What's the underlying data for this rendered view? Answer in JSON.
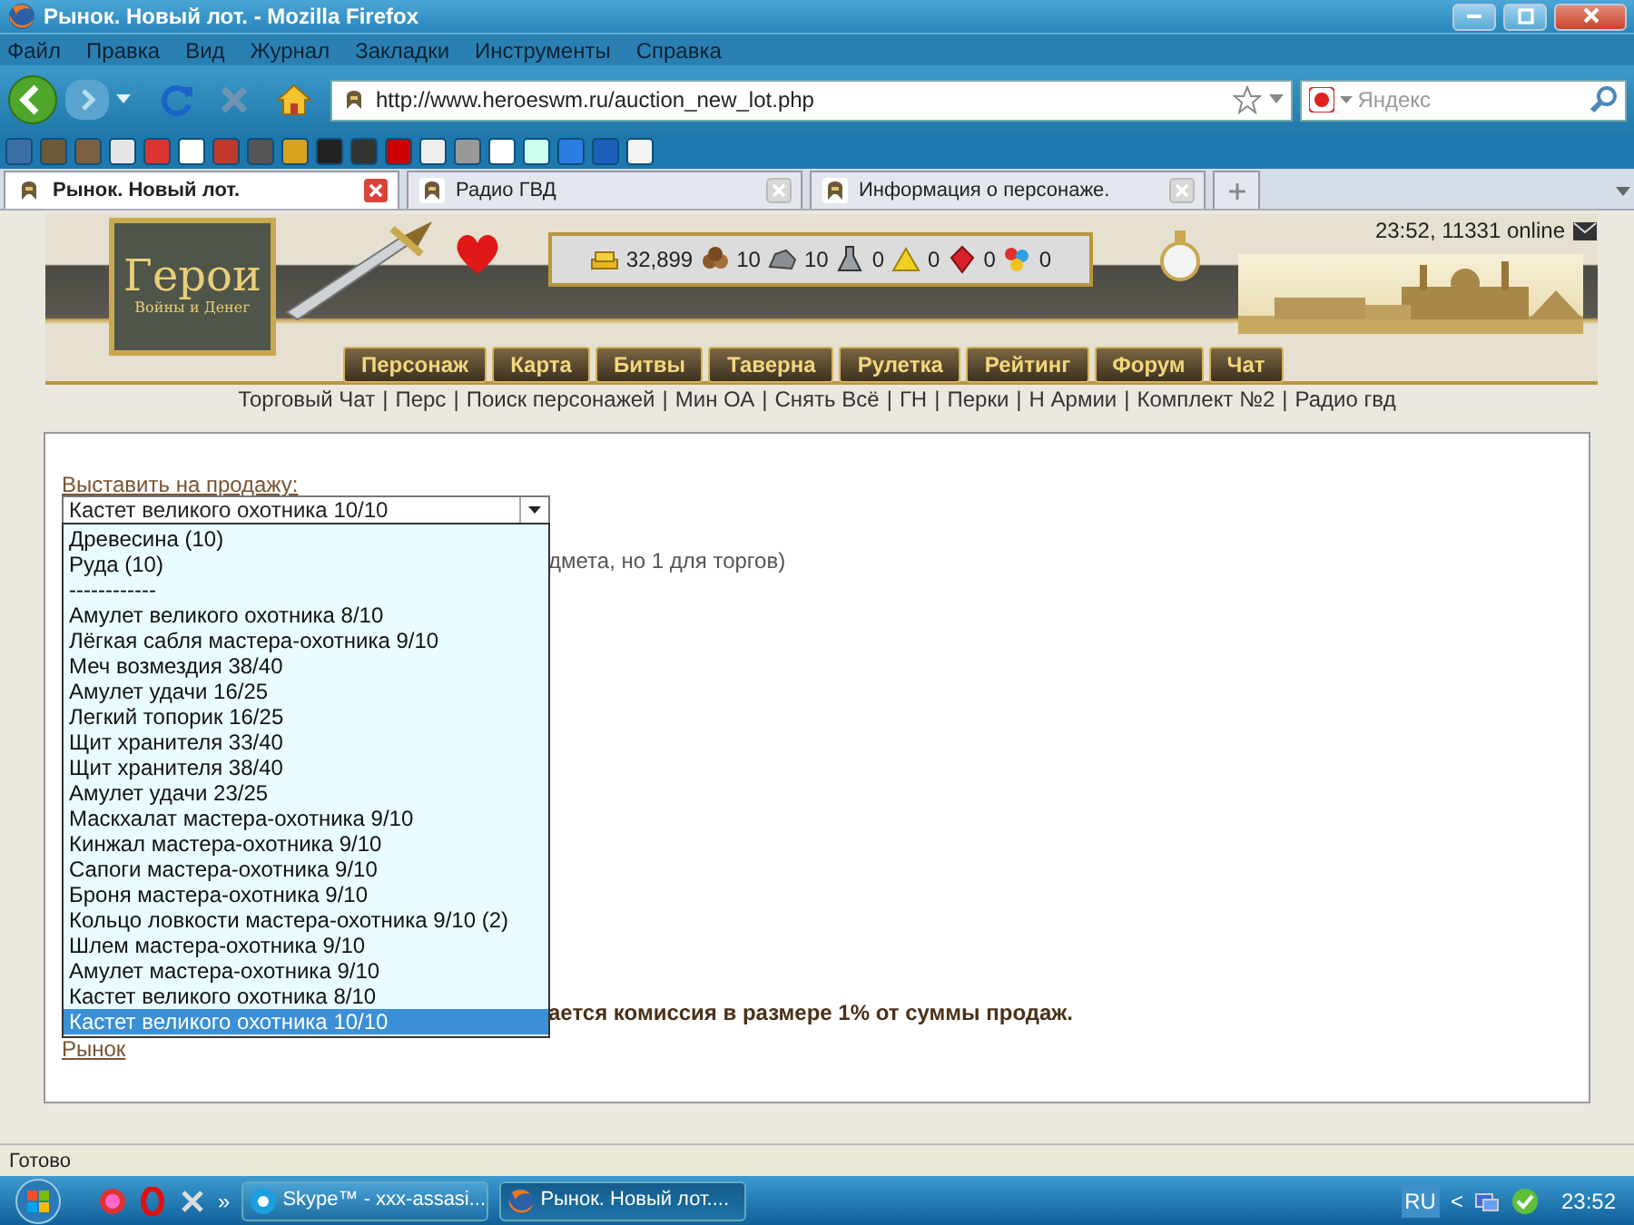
{
  "window": {
    "title": "Рынок. Новый лот. - Mozilla Firefox"
  },
  "menu": [
    "Файл",
    "Правка",
    "Вид",
    "Журнал",
    "Закладки",
    "Инструменты",
    "Справка"
  ],
  "address_bar": {
    "url": "http://www.heroeswm.ru/auction_new_lot.php"
  },
  "search": {
    "placeholder": "Яндекс"
  },
  "tabs": [
    {
      "label": "Рынок. Новый лот.",
      "selected": true
    },
    {
      "label": "Радио ГВД",
      "selected": false
    },
    {
      "label": "Информация о персонаже.",
      "selected": false
    }
  ],
  "game_header": {
    "logo_title": "Герои",
    "logo_subtitle": "Войны и Денег",
    "clock_online": "23:52, 11331 online",
    "resources": [
      {
        "kind": "gold",
        "value": "32,899"
      },
      {
        "kind": "wood",
        "value": "10"
      },
      {
        "kind": "ore",
        "value": "10"
      },
      {
        "kind": "mercury",
        "value": "0"
      },
      {
        "kind": "sulfur",
        "value": "0"
      },
      {
        "kind": "crystal",
        "value": "0"
      },
      {
        "kind": "gems",
        "value": "0"
      }
    ],
    "nav": [
      "Персонаж",
      "Карта",
      "Битвы",
      "Таверна",
      "Рулетка",
      "Рейтинг",
      "Форум",
      "Чат"
    ]
  },
  "quick_links": {
    "separator": "|",
    "items": [
      "Торговый Чат",
      "Перс",
      "Поиск персонажей",
      "Мин ОА",
      "Снять Всё",
      "ГН",
      "Перки",
      "Н Армии",
      "Комплект №2",
      "Радио гвд"
    ]
  },
  "form": {
    "label": "Выставить на продажу:",
    "select_value": "Кастет великого охотника 10/10",
    "options": [
      {
        "label": "Древесина (10)",
        "selected": false
      },
      {
        "label": "Руда (10)",
        "selected": false
      },
      {
        "label": "------------",
        "selected": false
      },
      {
        "label": "Амулет великого охотника 8/10",
        "selected": false
      },
      {
        "label": "Лёгкая сабля мастера-охотника 9/10",
        "selected": false
      },
      {
        "label": "Меч возмездия 38/40",
        "selected": false
      },
      {
        "label": "Амулет удачи 16/25",
        "selected": false
      },
      {
        "label": "Легкий топорик 16/25",
        "selected": false
      },
      {
        "label": "Щит хранителя 33/40",
        "selected": false
      },
      {
        "label": "Щит хранителя 38/40",
        "selected": false
      },
      {
        "label": "Амулет удачи 23/25",
        "selected": false
      },
      {
        "label": "Маскхалат мастера-охотника 9/10",
        "selected": false
      },
      {
        "label": "Кинжал мастера-охотника 9/10",
        "selected": false
      },
      {
        "label": "Сапоги мастера-охотника 9/10",
        "selected": false
      },
      {
        "label": "Броня мастера-охотника 9/10",
        "selected": false
      },
      {
        "label": "Кольцо ловкости мастера-охотника 9/10 (2)",
        "selected": false
      },
      {
        "label": "Шлем мастера-охотника 9/10",
        "selected": false
      },
      {
        "label": "Амулет мастера-охотника 9/10",
        "selected": false
      },
      {
        "label": "Кастет великого охотника 8/10",
        "selected": false
      },
      {
        "label": "Кастет великого охотника 10/10",
        "selected": true
      }
    ],
    "quantity_note": "дмета, но 1 для торгов)",
    "commission_note": "ается комиссия в размере 1% от суммы продаж.",
    "back_link": "Рынок"
  },
  "status_bar": "Готово",
  "taskbar": {
    "more": "»",
    "windows": [
      {
        "label": "Skype™ - xxx-assasi...",
        "kind": "skype",
        "selected": false
      },
      {
        "label": "Рынок. Новый лот....",
        "kind": "firefox",
        "selected": true
      }
    ],
    "language": "RU",
    "tray_arrow": "<",
    "clock": "23:52"
  }
}
